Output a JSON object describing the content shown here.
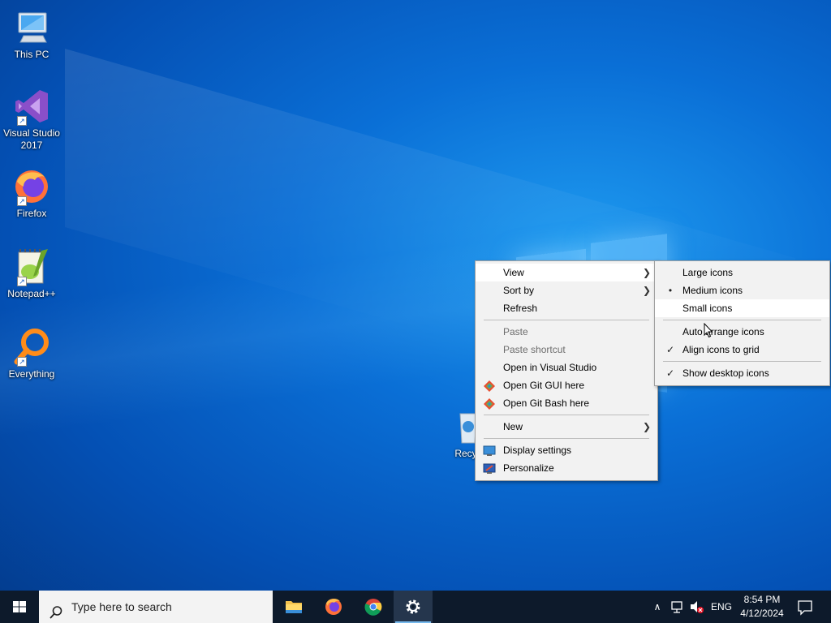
{
  "desktop": {
    "icons": [
      {
        "label": "This PC",
        "icon": "this-pc-icon"
      },
      {
        "label": "Visual Studio 2017",
        "icon": "visual-studio-icon"
      },
      {
        "label": "Firefox",
        "icon": "firefox-icon"
      },
      {
        "label": "Notepad++",
        "icon": "notepad-plus-plus-icon"
      },
      {
        "label": "Everything",
        "icon": "everything-search-icon"
      },
      {
        "label": "Recyc",
        "icon": "recycle-bin-icon"
      }
    ]
  },
  "context_menu": {
    "items": [
      {
        "label": "View",
        "submenu": true,
        "state": "highlighted"
      },
      {
        "label": "Sort by",
        "submenu": true
      },
      {
        "label": "Refresh"
      },
      {
        "label": "Paste",
        "disabled": true
      },
      {
        "label": "Paste shortcut",
        "disabled": true
      },
      {
        "label": "Open in Visual Studio"
      },
      {
        "label": "Open Git GUI here",
        "icon": "git-gui-icon"
      },
      {
        "label": "Open Git Bash here",
        "icon": "git-bash-icon"
      },
      {
        "label": "New",
        "submenu": true
      },
      {
        "label": "Display settings",
        "icon": "display-settings-icon"
      },
      {
        "label": "Personalize",
        "icon": "personalize-icon"
      }
    ]
  },
  "view_submenu": {
    "items": [
      {
        "label": "Large icons"
      },
      {
        "label": "Medium icons",
        "mark": "•"
      },
      {
        "label": "Small icons",
        "state": "hovered"
      },
      {
        "label": "Auto arrange icons"
      },
      {
        "label": "Align icons to grid",
        "mark": "✓"
      },
      {
        "label": "Show desktop icons",
        "mark": "✓"
      }
    ]
  },
  "taskbar": {
    "search_placeholder": "Type here to search",
    "apps": [
      "file-explorer-icon",
      "firefox-icon",
      "chrome-icon",
      "settings-icon"
    ],
    "active_app": "settings-icon",
    "tray": {
      "language": "ENG",
      "time": "8:54 PM",
      "date": "4/12/2024"
    }
  },
  "colors": {
    "taskbar_bg": "#0d1a2b",
    "menu_bg": "#f2f2f2",
    "accent": "#76b9ed"
  }
}
